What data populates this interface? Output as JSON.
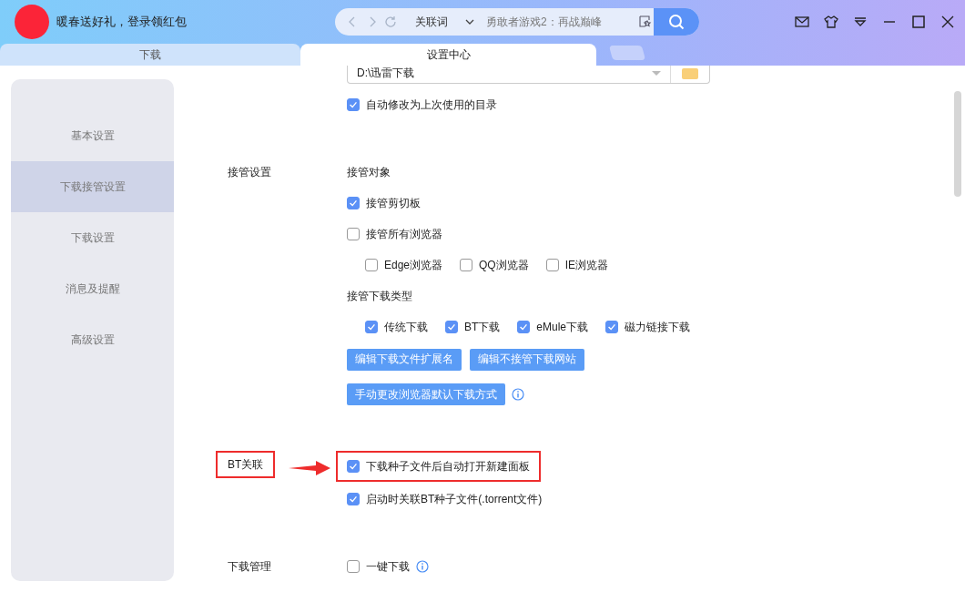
{
  "header": {
    "promo": "暖春送好礼，登录领红包",
    "search": {
      "scope": "关联词",
      "placeholder": "勇敢者游戏2：再战巅峰"
    }
  },
  "tabs": [
    {
      "label": "下载",
      "selected": false
    },
    {
      "label": "设置中心",
      "selected": true
    }
  ],
  "sidebar": {
    "items": [
      {
        "label": "基本设置",
        "selected": false
      },
      {
        "label": "下载接管设置",
        "selected": true
      },
      {
        "label": "下载设置",
        "selected": false
      },
      {
        "label": "消息及提醒",
        "selected": false
      },
      {
        "label": "高级设置",
        "selected": false
      }
    ]
  },
  "sections": [
    {
      "rows": [
        {
          "kind": "path",
          "value": "D:\\迅雷下载"
        },
        {
          "kind": "check",
          "label": "自动修改为上次使用的目录",
          "checked": true
        }
      ]
    },
    {
      "label": "接管设置",
      "rows": [
        {
          "kind": "heading",
          "text": "接管对象"
        },
        {
          "kind": "check",
          "label": "接管剪切板",
          "checked": true
        },
        {
          "kind": "check",
          "label": "接管所有浏览器",
          "checked": false
        },
        {
          "kind": "group",
          "items": [
            {
              "label": "Edge浏览器",
              "checked": false
            },
            {
              "label": "QQ浏览器",
              "checked": false
            },
            {
              "label": "IE浏览器",
              "checked": false
            }
          ]
        },
        {
          "kind": "heading",
          "text": "接管下载类型"
        },
        {
          "kind": "group",
          "items": [
            {
              "label": "传统下载",
              "checked": true
            },
            {
              "label": "BT下载",
              "checked": true
            },
            {
              "label": "eMule下载",
              "checked": true
            },
            {
              "label": "磁力链接下载",
              "checked": true
            }
          ]
        },
        {
          "kind": "buttons",
          "buttons": [
            "编辑下载文件扩展名",
            "编辑不接管下载网站"
          ]
        },
        {
          "kind": "buttons",
          "buttons": [
            "手动更改浏览器默认下载方式"
          ],
          "info": true
        }
      ]
    },
    {
      "label": "BT关联",
      "highlighted": true,
      "rows": [
        {
          "kind": "check",
          "label": "下载种子文件后自动打开新建面板",
          "checked": true,
          "highlighted": true
        },
        {
          "kind": "check",
          "label": "启动时关联BT种子文件(.torrent文件)",
          "checked": true
        }
      ]
    },
    {
      "label": "下载管理",
      "rows": [
        {
          "kind": "check",
          "label": "一键下载",
          "checked": false,
          "info": true
        }
      ]
    }
  ]
}
